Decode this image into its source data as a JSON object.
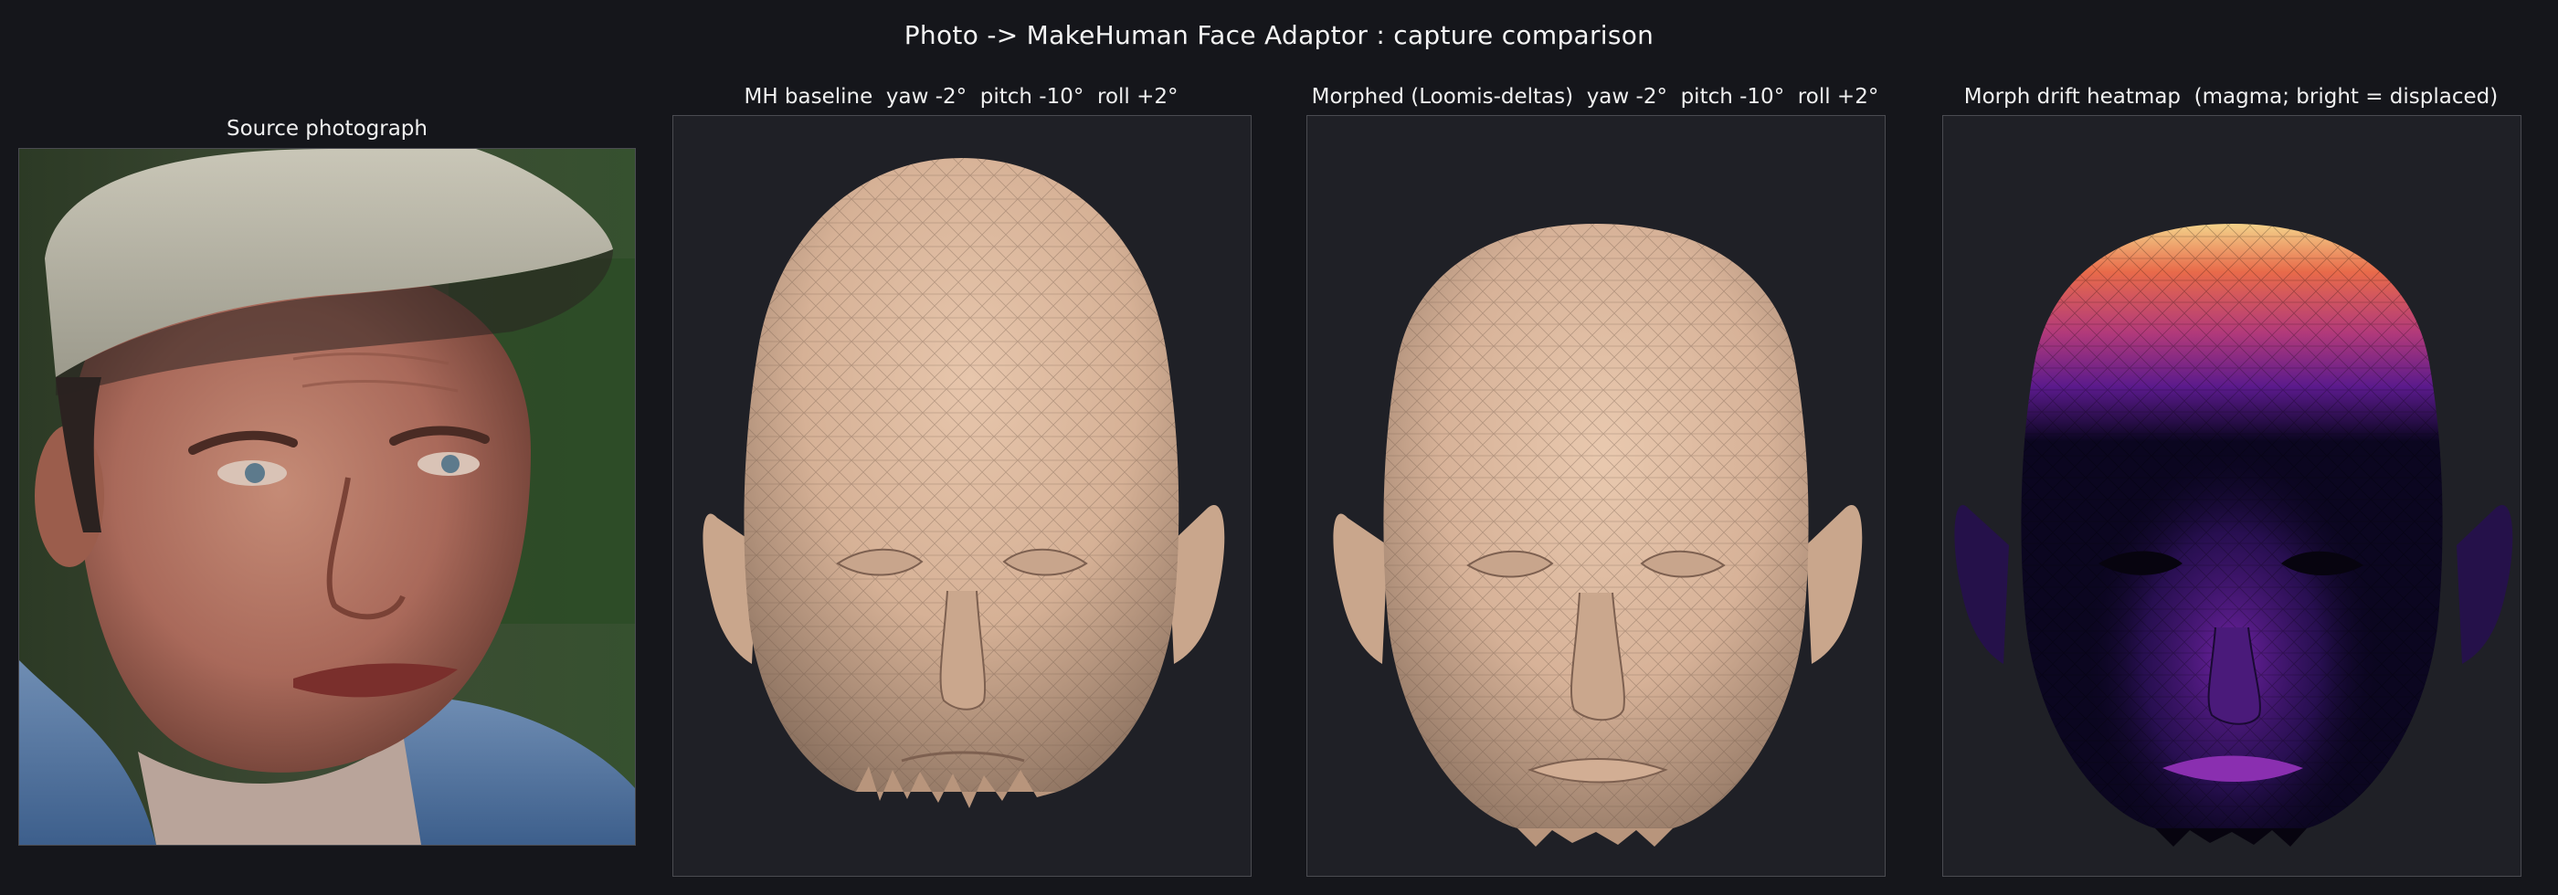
{
  "figure": {
    "title": "Photo -> MakeHuman Face Adaptor : capture comparison",
    "panels": [
      {
        "caption": "Source photograph",
        "content": "portrait photograph of a man wearing a light baseball cap and a blue shirt"
      },
      {
        "caption": "MH baseline  yaw -2°  pitch -10°  roll +2°",
        "content": "skin-toned wireframe head mesh"
      },
      {
        "caption": "Morphed (Loomis-deltas)  yaw -2°  pitch -10°  roll +2°",
        "content": "skin-toned wireframe head mesh, morphed"
      },
      {
        "caption": "Morph drift heatmap  (magma; bright = displaced)",
        "content": "head mesh colored by displacement, bright crown"
      }
    ]
  },
  "colors": {
    "background": "#15161b",
    "panel_bg": "#1f2026",
    "frame_border": "#4a4b51",
    "skin": "#d8b398",
    "heat_dark": "#0b0620",
    "heat_mid": "#5a1a8c",
    "heat_hot": "#e86a4a",
    "heat_bright": "#f3d28a"
  }
}
